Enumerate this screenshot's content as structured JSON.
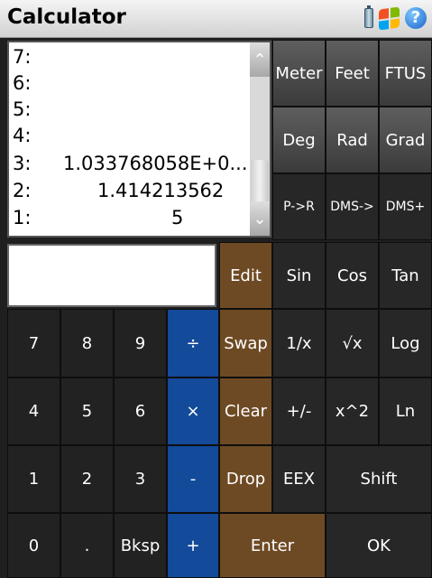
{
  "window": {
    "title": "Calculator"
  },
  "tray": {
    "battery": "battery-icon",
    "start": "windows-start-icon",
    "help": "help-icon",
    "help_glyph": "?"
  },
  "stack": {
    "rows": [
      {
        "label": "7:",
        "value": ""
      },
      {
        "label": "6:",
        "value": ""
      },
      {
        "label": "5:",
        "value": ""
      },
      {
        "label": "4:",
        "value": ""
      },
      {
        "label": "3:",
        "value": "1.033768058E+0..."
      },
      {
        "label": "2:",
        "value": "1.414213562"
      },
      {
        "label": "1:",
        "value": "5"
      }
    ]
  },
  "scroll": {
    "up_glyph": "⌃",
    "down_glyph": "⌄"
  },
  "entry": {
    "value": ""
  },
  "buttons": {
    "meter": "Meter",
    "feet": "Feet",
    "ftus": "FTUS",
    "deg": "Deg",
    "rad": "Rad",
    "grad": "Grad",
    "p_to_r": "P->R",
    "dms_to": "DMS->",
    "dms_plus": "DMS+",
    "edit": "Edit",
    "sin": "Sin",
    "cos": "Cos",
    "tan": "Tan",
    "seven": "7",
    "eight": "8",
    "nine": "9",
    "divide": "÷",
    "swap": "Swap",
    "reciprocal": "1/x",
    "sqrt": "√x",
    "log": "Log",
    "four": "4",
    "five": "5",
    "six": "6",
    "multiply": "×",
    "clear": "Clear",
    "negate": "+/-",
    "square": "x^2",
    "ln": "Ln",
    "one": "1",
    "two": "2",
    "three": "3",
    "minus": "-",
    "drop": "Drop",
    "eex": "EEX",
    "shift": "Shift",
    "zero": "0",
    "point": ".",
    "bksp": "Bksp",
    "plus": "+",
    "enter": "Enter",
    "ok": "OK"
  },
  "colors": {
    "operator_blue": "#134a9a",
    "stack_brown": "#6e4a24",
    "key_dark": "#222222"
  }
}
